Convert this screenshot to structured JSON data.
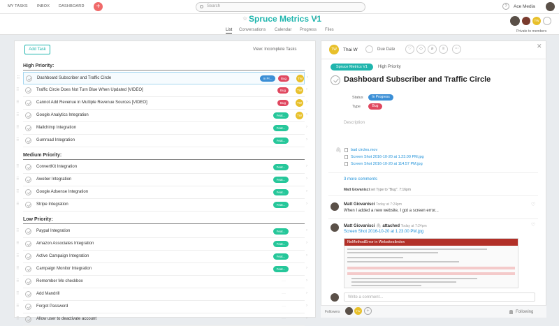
{
  "topnav": {
    "my_tasks": "MY TASKS",
    "inbox": "INBOX",
    "dashboard": "DASHBOARD",
    "add_icon": "plus-icon",
    "search_placeholder": "Search",
    "help": "?",
    "account": "Ace Media"
  },
  "project": {
    "title": "Spruce Metrics V1",
    "private_label": "Private to members",
    "member_badge": "TW"
  },
  "tabs": [
    "List",
    "Conversations",
    "Calendar",
    "Progress",
    "Files"
  ],
  "list": {
    "add_task": "Add Task",
    "view": "View: Incomplete Tasks",
    "sections": [
      {
        "name": "High Priority:",
        "tasks": [
          {
            "name": "Dashboard Subscriber and Traffic Circle",
            "tags": [
              {
                "label": "In Pr...",
                "color": "#3b8fd6"
              },
              {
                "label": "Bug",
                "color": "#e04860"
              }
            ],
            "assignee": "TW",
            "selected": true
          },
          {
            "name": "Traffic Circle Does Not Turn Blue When Updated [VIDEO]",
            "tags": [
              {
                "label": "Bug",
                "color": "#e04860"
              }
            ],
            "assignee": "TW"
          },
          {
            "name": "Cannot Add Revenue in Multiple Revenue Sources [VIDEO]",
            "tags": [
              {
                "label": "Bug",
                "color": "#e04860"
              }
            ],
            "assignee": "TW"
          },
          {
            "name": "Google Analytics Integration",
            "tags": [
              {
                "label": "Feat...",
                "color": "#26c79a"
              }
            ],
            "assignee": "TW"
          },
          {
            "name": "Mailchimp Integration",
            "tags": [
              {
                "label": "Feat...",
                "color": "#26c79a"
              }
            ],
            "assignee": ""
          },
          {
            "name": "Gumroad Integration",
            "tags": [
              {
                "label": "Feat...",
                "color": "#26c79a"
              }
            ],
            "assignee": ""
          }
        ]
      },
      {
        "name": "Medium Priority:",
        "tasks": [
          {
            "name": "ConvertKit Integration",
            "tags": [
              {
                "label": "Feat...",
                "color": "#26c79a"
              }
            ],
            "assignee": ""
          },
          {
            "name": "Aweber Integration",
            "tags": [
              {
                "label": "Feat...",
                "color": "#26c79a"
              }
            ],
            "assignee": ""
          },
          {
            "name": "Google Adsense Integration",
            "tags": [
              {
                "label": "Feat...",
                "color": "#26c79a"
              }
            ],
            "assignee": ""
          },
          {
            "name": "Stripe Integration",
            "tags": [
              {
                "label": "Feat...",
                "color": "#26c79a"
              }
            ],
            "assignee": ""
          }
        ]
      },
      {
        "name": "Low Priority:",
        "tasks": [
          {
            "name": "Paypal Integration",
            "tags": [
              {
                "label": "Feat...",
                "color": "#26c79a"
              }
            ],
            "assignee": ""
          },
          {
            "name": "Amazon Associates Integration",
            "tags": [
              {
                "label": "Feat...",
                "color": "#26c79a"
              }
            ],
            "assignee": ""
          },
          {
            "name": "Active Campaign Integration",
            "tags": [
              {
                "label": "Feat...",
                "color": "#26c79a"
              }
            ],
            "assignee": ""
          },
          {
            "name": "Campaign Monitor Integration",
            "tags": [
              {
                "label": "Feat...",
                "color": "#26c79a"
              }
            ],
            "assignee": ""
          },
          {
            "name": "Remember Me checkbox",
            "tags": [],
            "assignee": ""
          },
          {
            "name": "Add Mandrill",
            "tags": [],
            "assignee": ""
          },
          {
            "name": "Forgot Password",
            "tags": [],
            "assignee": ""
          },
          {
            "name": "Allow user to deactivate account",
            "tags": [],
            "assignee": ""
          }
        ]
      }
    ]
  },
  "detail": {
    "assignee_initials": "TW",
    "assignee_name": "Thai W",
    "due_date": "Due Date",
    "project_pill": "Spruce Metrics V1",
    "priority": "High Priority",
    "title": "Dashboard Subscriber and Traffic Circle",
    "status_label": "Status",
    "status_value": "In Progress",
    "type_label": "Type",
    "type_value": "Bug",
    "description_placeholder": "Description",
    "attachments": [
      "bad circles.mov",
      "Screen Shot 2016-10-20 at 1.23.00 PM.jpg",
      "Screen Shot 2016-10-20 at 114.57 PM.jpg"
    ],
    "more_comments": "3 more comments",
    "story": {
      "author": "Matt Giovanisci",
      "text": "set Type to \"Bug\".",
      "time": "7:16pm"
    },
    "comments": [
      {
        "author": "Matt Giovanisci",
        "date": "Today at 7:24pm",
        "text": "When I added a new website, I got a screen error..."
      },
      {
        "author": "Matt Giovanisci",
        "action": "attached",
        "date": "Today at 7:24pm",
        "text": "Screen Shot 2016-10-20 at 1.23.00 PM.jpg"
      }
    ],
    "screenshot_title": "NoMethodError in WebsitesIindex",
    "comment_placeholder": "Write a comment...",
    "followers_label": "Followers",
    "followers_badge": "TW",
    "following": "Following"
  }
}
